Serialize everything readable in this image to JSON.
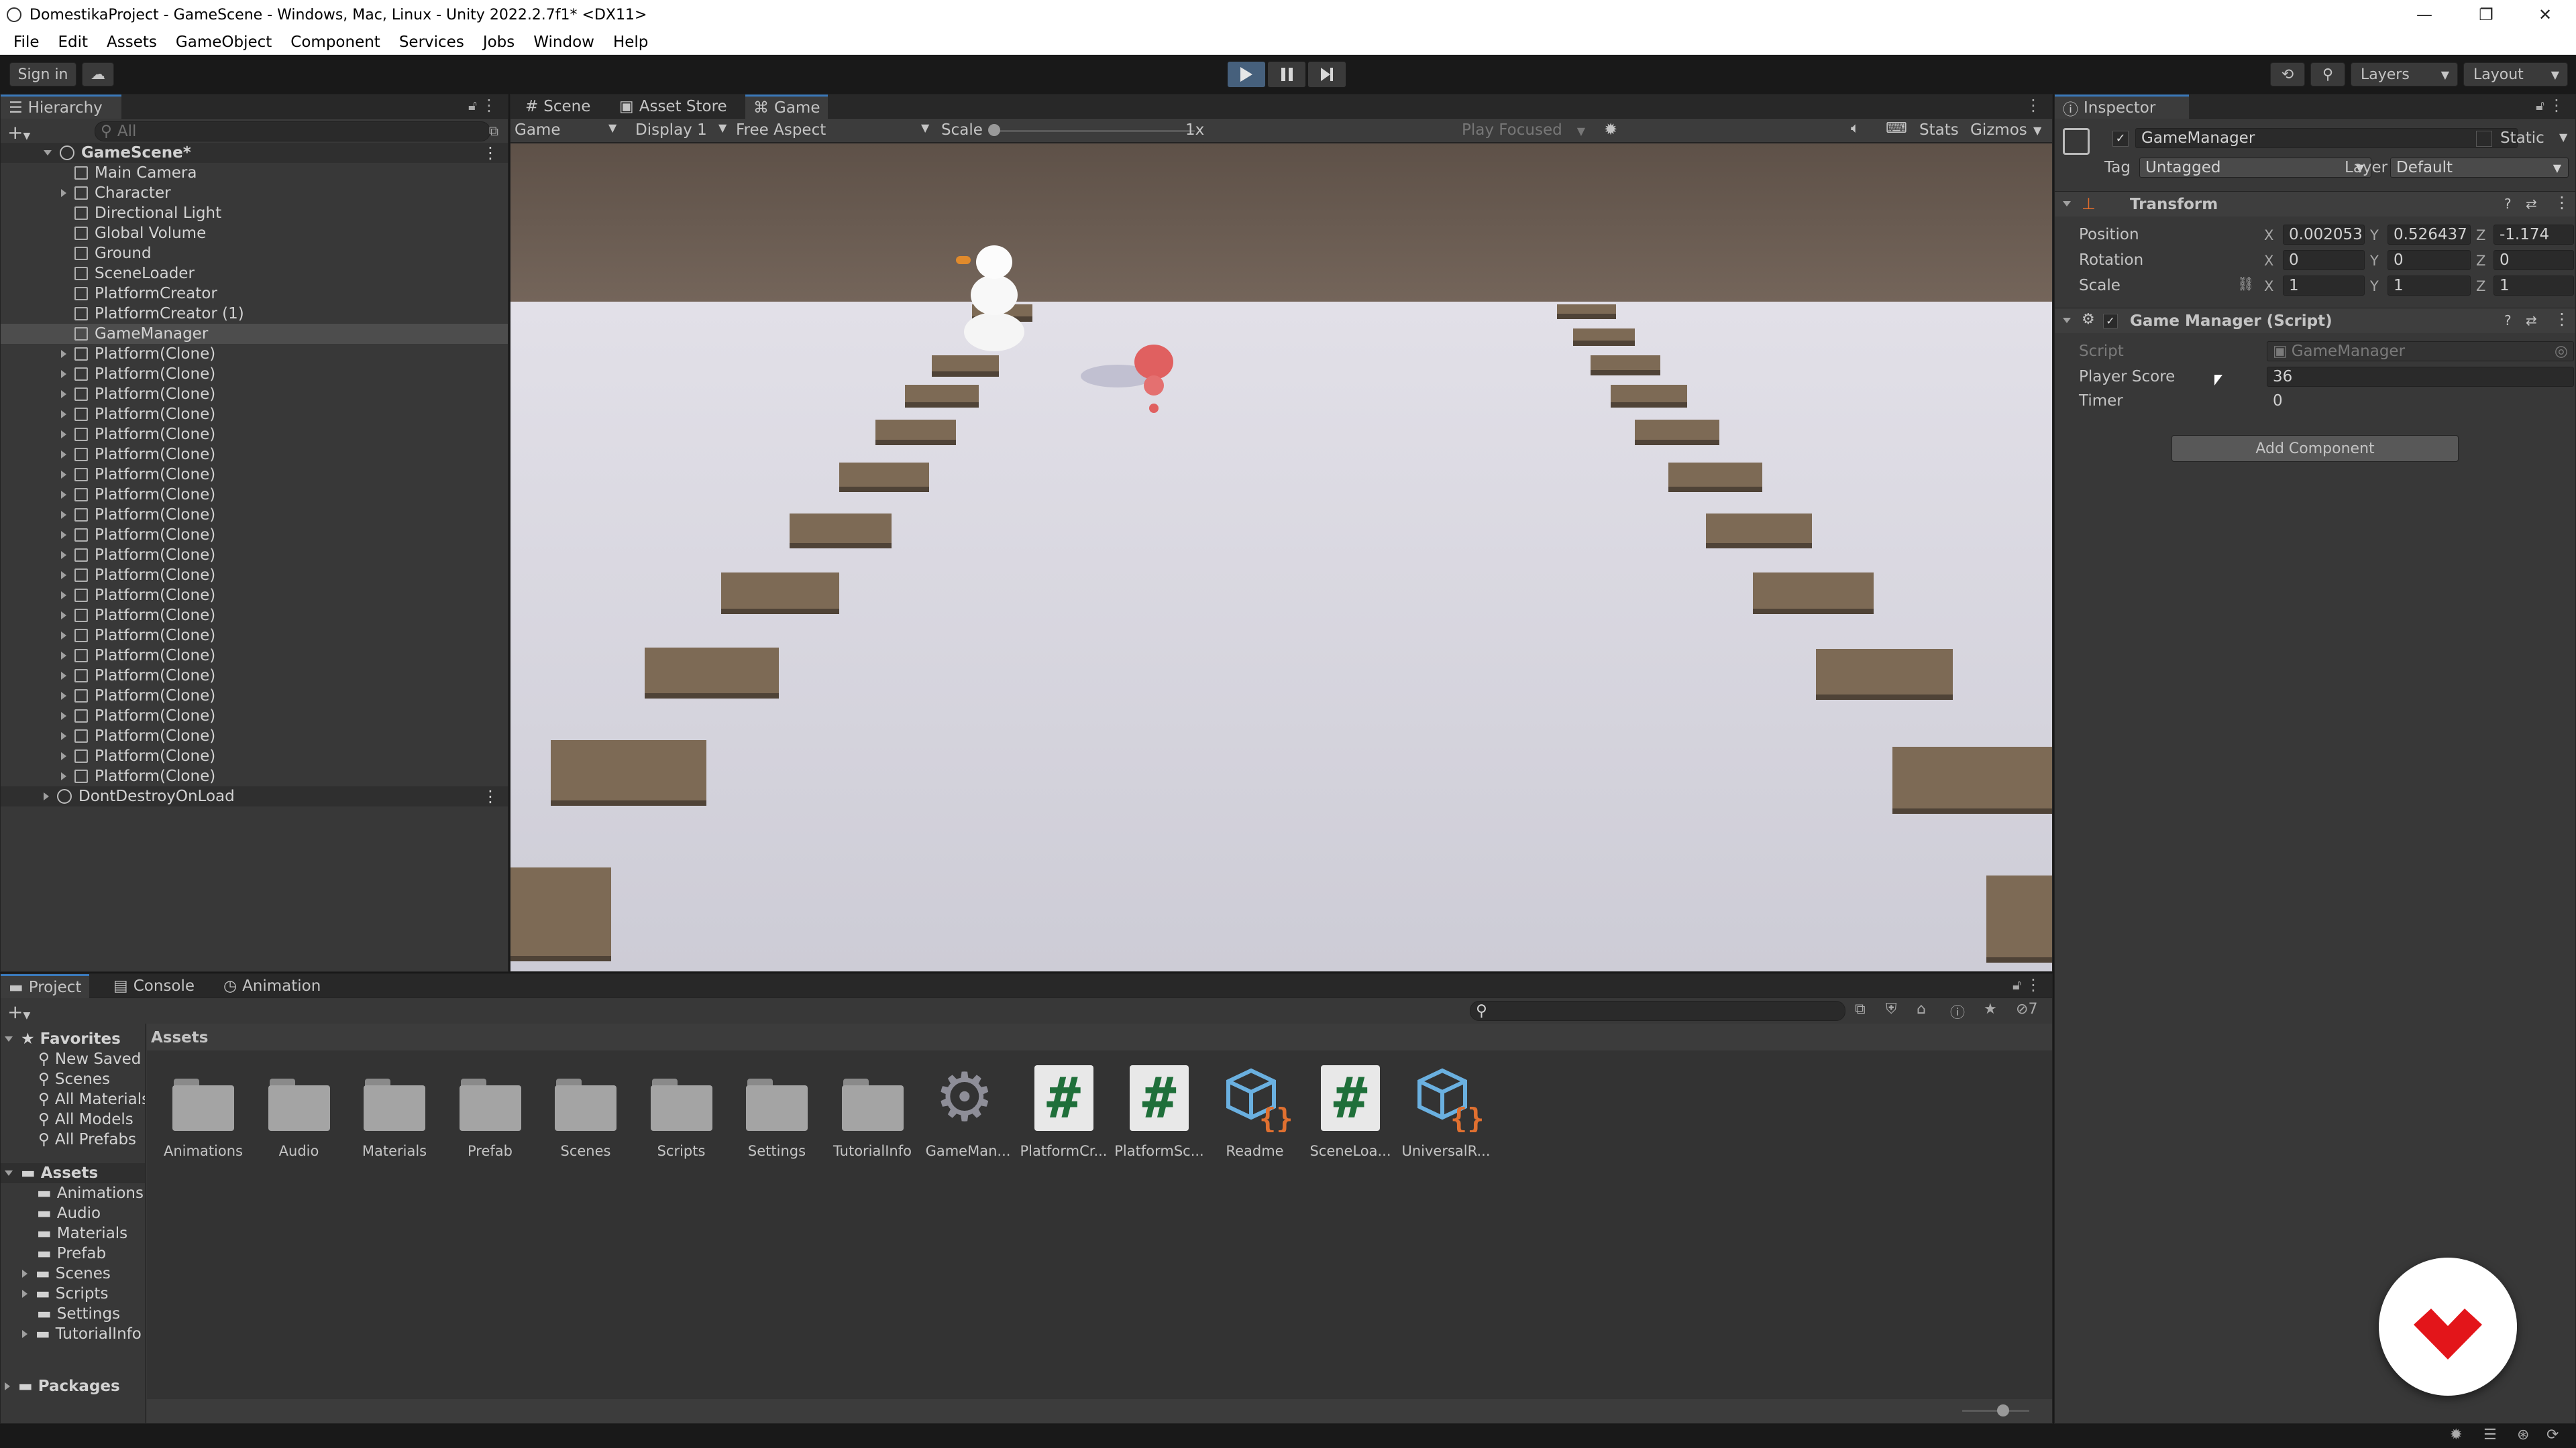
{
  "window": {
    "title": "DomestikaProject - GameScene - Windows, Mac, Linux - Unity 2022.2.7f1* <DX11>",
    "minimize": "—",
    "maximize": "❐",
    "close": "✕"
  },
  "menu": [
    "File",
    "Edit",
    "Assets",
    "GameObject",
    "Component",
    "Services",
    "Jobs",
    "Window",
    "Help"
  ],
  "toolbar": {
    "sign_in": "Sign in",
    "layers": "Layers",
    "layout": "Layout"
  },
  "hierarchy": {
    "tab": "Hierarchy",
    "search_placeholder": "All",
    "scene": "GameScene*",
    "items": [
      {
        "label": "Main Camera",
        "expandable": false
      },
      {
        "label": "Character",
        "expandable": true
      },
      {
        "label": "Directional Light",
        "expandable": false
      },
      {
        "label": "Global Volume",
        "expandable": false
      },
      {
        "label": "Ground",
        "expandable": false
      },
      {
        "label": "SceneLoader",
        "expandable": false
      },
      {
        "label": "PlatformCreator",
        "expandable": false
      },
      {
        "label": "PlatformCreator (1)",
        "expandable": false
      },
      {
        "label": "GameManager",
        "expandable": false,
        "selected": true
      },
      {
        "label": "Platform(Clone)",
        "expandable": true
      },
      {
        "label": "Platform(Clone)",
        "expandable": true
      },
      {
        "label": "Platform(Clone)",
        "expandable": true
      },
      {
        "label": "Platform(Clone)",
        "expandable": true
      },
      {
        "label": "Platform(Clone)",
        "expandable": true
      },
      {
        "label": "Platform(Clone)",
        "expandable": true
      },
      {
        "label": "Platform(Clone)",
        "expandable": true
      },
      {
        "label": "Platform(Clone)",
        "expandable": true
      },
      {
        "label": "Platform(Clone)",
        "expandable": true
      },
      {
        "label": "Platform(Clone)",
        "expandable": true
      },
      {
        "label": "Platform(Clone)",
        "expandable": true
      },
      {
        "label": "Platform(Clone)",
        "expandable": true
      },
      {
        "label": "Platform(Clone)",
        "expandable": true
      },
      {
        "label": "Platform(Clone)",
        "expandable": true
      },
      {
        "label": "Platform(Clone)",
        "expandable": true
      },
      {
        "label": "Platform(Clone)",
        "expandable": true
      },
      {
        "label": "Platform(Clone)",
        "expandable": true
      },
      {
        "label": "Platform(Clone)",
        "expandable": true
      },
      {
        "label": "Platform(Clone)",
        "expandable": true
      },
      {
        "label": "Platform(Clone)",
        "expandable": true
      },
      {
        "label": "Platform(Clone)",
        "expandable": true
      },
      {
        "label": "Platform(Clone)",
        "expandable": true
      }
    ],
    "dont_destroy": "DontDestroyOnLoad"
  },
  "view": {
    "tabs": [
      "Scene",
      "Asset Store",
      "Game"
    ],
    "active_tab": "Game",
    "game_dropdown": "Game",
    "display": "Display 1",
    "aspect": "Free Aspect",
    "scale_label": "Scale",
    "scale_value": "1x",
    "play_focused": "Play Focused",
    "stats": "Stats",
    "gizmos": "Gizmos"
  },
  "inspector": {
    "tab": "Inspector",
    "object_name": "GameManager",
    "static_label": "Static",
    "tag_label": "Tag",
    "tag_value": "Untagged",
    "layer_label": "Layer",
    "layer_value": "Default",
    "transform": {
      "title": "Transform",
      "position_label": "Position",
      "rotation_label": "Rotation",
      "scale_label": "Scale",
      "position": {
        "x": "0.002053",
        "y": "0.526437",
        "z": "-1.174"
      },
      "rotation": {
        "x": "0",
        "y": "0",
        "z": "0"
      },
      "scale": {
        "x": "1",
        "y": "1",
        "z": "1"
      }
    },
    "script_component": {
      "title": "Game Manager (Script)",
      "script_label": "Script",
      "script_value": "GameManager",
      "player_score_label": "Player Score",
      "player_score_value": "36",
      "timer_label": "Timer",
      "timer_value": "0"
    },
    "add_component": "Add Component"
  },
  "project": {
    "tabs": [
      "Project",
      "Console",
      "Animation"
    ],
    "favorites_label": "Favorites",
    "favorites": [
      "New Saved",
      "Scenes",
      "All Materials",
      "All Models",
      "All Prefabs"
    ],
    "assets_root": "Assets",
    "asset_folders": [
      "Animations",
      "Audio",
      "Materials",
      "Prefab",
      "Scenes",
      "Scripts",
      "Settings",
      "TutorialInfo"
    ],
    "packages": "Packages",
    "breadcrumb": "Assets",
    "hidden_count": "7",
    "grid": [
      {
        "label": "Animations",
        "kind": "folder"
      },
      {
        "label": "Audio",
        "kind": "folder"
      },
      {
        "label": "Materials",
        "kind": "folder"
      },
      {
        "label": "Prefab",
        "kind": "folder"
      },
      {
        "label": "Scenes",
        "kind": "folder"
      },
      {
        "label": "Scripts",
        "kind": "folder"
      },
      {
        "label": "Settings",
        "kind": "folder"
      },
      {
        "label": "TutorialInfo",
        "kind": "folder"
      },
      {
        "label": "GameMan...",
        "kind": "gear"
      },
      {
        "label": "PlatformCr...",
        "kind": "script"
      },
      {
        "label": "PlatformSc...",
        "kind": "script"
      },
      {
        "label": "Readme",
        "kind": "json"
      },
      {
        "label": "SceneLoa...",
        "kind": "script"
      },
      {
        "label": "UniversalR...",
        "kind": "json"
      }
    ]
  },
  "colors": {
    "accent": "#3a79bb",
    "brand": "#e3151a",
    "selection": "#4d4d4d"
  }
}
